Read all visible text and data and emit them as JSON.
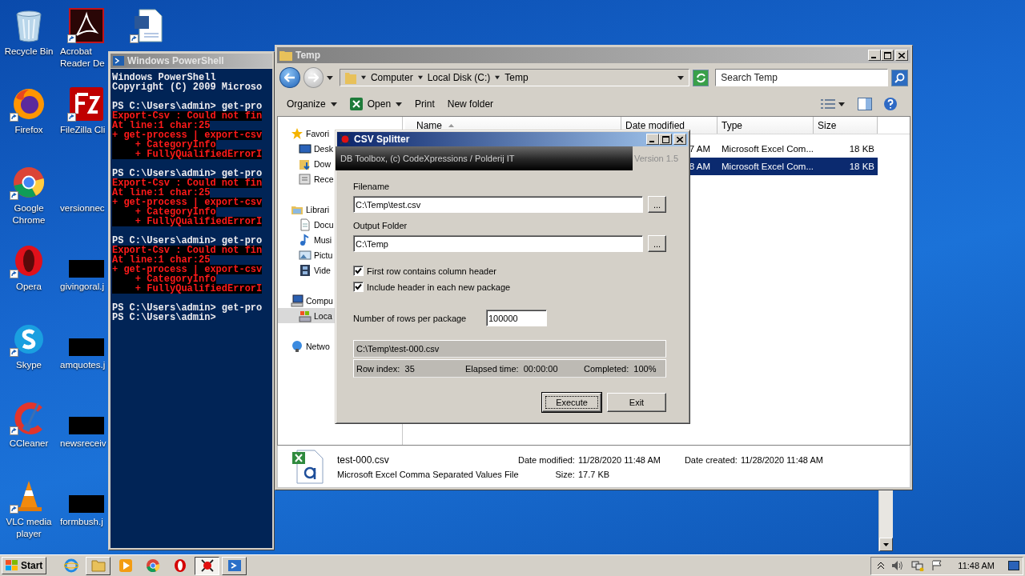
{
  "desktop_icons": [
    {
      "label": "Recycle Bin",
      "kind": "recycle",
      "shortcut": false
    },
    {
      "label": "Firefox",
      "kind": "firefox",
      "shortcut": true
    },
    {
      "label": "Google Chrome",
      "kind": "chrome",
      "shortcut": true
    },
    {
      "label": "Opera",
      "kind": "opera",
      "shortcut": true
    },
    {
      "label": "Skype",
      "kind": "skype",
      "shortcut": true
    },
    {
      "label": "CCleaner",
      "kind": "ccleaner",
      "shortcut": true
    },
    {
      "label": "VLC media player",
      "kind": "vlc",
      "shortcut": true
    },
    {
      "label": "Acrobat Reader De",
      "kind": "acrobat",
      "shortcut": true
    },
    {
      "label": "FileZilla Cli",
      "kind": "filezilla",
      "shortcut": true
    },
    {
      "label": "versionnec",
      "kind": "none",
      "shortcut": false
    },
    {
      "label": "givingoral.j",
      "kind": "redacted",
      "shortcut": false
    },
    {
      "label": "amquotes.j",
      "kind": "redacted",
      "shortcut": false
    },
    {
      "label": "newsreceiv",
      "kind": "redacted",
      "shortcut": false
    },
    {
      "label": "formbush.j",
      "kind": "redacted",
      "shortcut": false
    },
    {
      "kind": "word",
      "shortcut": true
    }
  ],
  "powershell": {
    "title": "Windows PowerShell",
    "lines": [
      {
        "kind": "output",
        "text": "Windows PowerShell"
      },
      {
        "kind": "output",
        "text": "Copyright (C) 2009 Microso"
      },
      {
        "kind": "blank"
      },
      {
        "kind": "output",
        "text": "PS C:\\Users\\admin> get-pro"
      },
      {
        "kind": "error",
        "text": "Export-Csv : Could not fin"
      },
      {
        "kind": "error",
        "text": "At line:1 char:25"
      },
      {
        "kind": "error",
        "text": "+ get-process | export-csv"
      },
      {
        "kind": "error",
        "text": "    + CategoryInfo"
      },
      {
        "kind": "error",
        "text": "    + FullyQualifiedErrorI"
      },
      {
        "kind": "blank"
      },
      {
        "kind": "output",
        "text": "PS C:\\Users\\admin> get-pro"
      },
      {
        "kind": "error",
        "text": "Export-Csv : Could not fin"
      },
      {
        "kind": "error",
        "text": "At line:1 char:25"
      },
      {
        "kind": "error",
        "text": "+ get-process | export-csv"
      },
      {
        "kind": "error",
        "text": "    + CategoryInfo"
      },
      {
        "kind": "error",
        "text": "    + FullyQualifiedErrorI"
      },
      {
        "kind": "blank"
      },
      {
        "kind": "output",
        "text": "PS C:\\Users\\admin> get-pro"
      },
      {
        "kind": "error",
        "text": "Export-Csv : Could not fin"
      },
      {
        "kind": "error",
        "text": "At line:1 char:25"
      },
      {
        "kind": "error",
        "text": "+ get-process | export-csv"
      },
      {
        "kind": "error",
        "text": "    + CategoryInfo"
      },
      {
        "kind": "error",
        "text": "    + FullyQualifiedErrorI"
      },
      {
        "kind": "blank"
      },
      {
        "kind": "output",
        "text": "PS C:\\Users\\admin> get-pro"
      },
      {
        "kind": "output",
        "text": "PS C:\\Users\\admin>"
      }
    ]
  },
  "explorer": {
    "title": "Temp",
    "breadcrumb": [
      "Computer",
      "Local Disk (C:)",
      "Temp"
    ],
    "search": {
      "placeholder": "Search Temp"
    },
    "toolbar": [
      {
        "label": "Organize",
        "kind": "text",
        "dropdown": true
      },
      {
        "label": "Open",
        "kind": "excel",
        "dropdown": true
      },
      {
        "label": "Print",
        "kind": "text",
        "dropdown": false
      },
      {
        "label": "New folder",
        "kind": "text",
        "dropdown": false
      }
    ],
    "nav": [
      {
        "label": "Favori",
        "kind": "star",
        "selected": false,
        "children": [
          {
            "label": "Desk",
            "kind": "desktop",
            "selected": false
          },
          {
            "label": "Dow",
            "kind": "download",
            "selected": false
          },
          {
            "label": "Rece",
            "kind": "recent",
            "selected": false
          }
        ]
      },
      {
        "label": "Librari",
        "kind": "library",
        "selected": false,
        "children": [
          {
            "label": "Docu",
            "kind": "document",
            "selected": false
          },
          {
            "label": "Musi",
            "kind": "music",
            "selected": false
          },
          {
            "label": "Pictu",
            "kind": "picture",
            "selected": false
          },
          {
            "label": "Vide",
            "kind": "video",
            "selected": false
          }
        ]
      },
      {
        "label": "Compu",
        "kind": "computer",
        "selected": false,
        "children": [
          {
            "label": "Loca",
            "kind": "disk",
            "selected": true
          }
        ]
      },
      {
        "label": "Netwo",
        "kind": "network",
        "selected": false
      }
    ],
    "columns": [
      "Name",
      "Date modified",
      "Type",
      "Size"
    ],
    "rows": [
      {
        "date_modified": "7 AM",
        "type": "Microsoft Excel Com...",
        "size": "18 KB",
        "selected": false
      },
      {
        "date_modified": "8 AM",
        "type": "Microsoft Excel Com...",
        "size": "18 KB",
        "selected": true
      }
    ],
    "details": {
      "name": "test-000.csv",
      "type": "Microsoft Excel Comma Separated Values File",
      "fields": [
        {
          "label": "Date modified:",
          "value": "11/28/2020 11:48 AM"
        },
        {
          "label": "Date created:",
          "value": "11/28/2020 11:48 AM"
        },
        {
          "label": "Size:",
          "value": "17.7 KB"
        }
      ]
    }
  },
  "csv_splitter": {
    "title": "CSV Splitter",
    "banner": "DB Toolbox, (c) CodeXpressions / Polderij IT",
    "version": "Version 1.5",
    "filename": {
      "label": "Filename",
      "value": "C:\\Temp\\test.csv",
      "browse": "..."
    },
    "output_folder": {
      "label": "Output Folder",
      "value": "C:\\Temp",
      "browse": "..."
    },
    "options": [
      {
        "label": "First row contains column header",
        "checked": true
      },
      {
        "label": "Include header in each new package",
        "checked": true
      }
    ],
    "rows_per_package": {
      "label": "Number of rows per package",
      "value": "100000"
    },
    "status": {
      "file": "C:\\Temp\\test-000.csv",
      "row_index": "Row index:  35",
      "elapsed": "Elapsed time:  00:00:00",
      "completed": "Completed:  100%"
    },
    "buttons": [
      {
        "label": "Execute",
        "default": true
      },
      {
        "label": "Exit",
        "default": false
      }
    ]
  },
  "taskbar": {
    "start": "Start",
    "apps": [
      {
        "kind": "ie",
        "open": false,
        "active": false
      },
      {
        "kind": "explorer",
        "open": true,
        "active": false
      },
      {
        "kind": "media",
        "open": false,
        "active": false
      },
      {
        "kind": "chrome",
        "open": false,
        "active": false
      },
      {
        "kind": "opera",
        "open": false,
        "active": false
      },
      {
        "kind": "csv",
        "open": true,
        "active": true
      },
      {
        "kind": "powershell",
        "open": true,
        "active": false
      }
    ],
    "clock": "11:48 AM"
  }
}
